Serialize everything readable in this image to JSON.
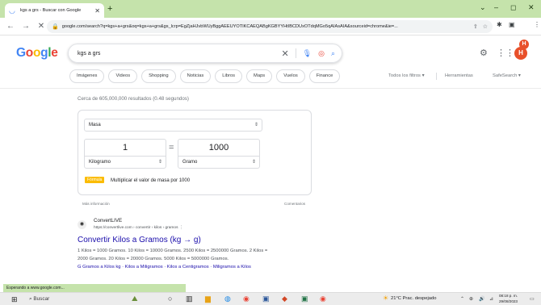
{
  "browser": {
    "tab_title": "kgs a grs - Buscar con Google",
    "url": "google.com/search?q=kgs+a+grs&oq=kgs+a+grs&gs_lcrp=EgZjaHJvbWUyBggAEEUYOTIKCAEQABgKGBYYHtIBCDUxOTdqMGo5qAIAsAIA&sourceid=chrome&ie=...",
    "status_text": "Esperando a www.google.com..."
  },
  "google": {
    "logo": "Google",
    "query": "kgs a grs",
    "avatar_letter": "H",
    "chips": [
      "Imágenes",
      "Videos",
      "Shopping",
      "Noticias",
      "Libros",
      "Maps",
      "Vuelos",
      "Finance"
    ],
    "filters": "Todos los filtros",
    "tools": "Herramientas",
    "safesearch": "SafeSearch",
    "stats": "Cerca de 605,000,000 resultados (0.48 segundos)"
  },
  "converter": {
    "category": "Masa",
    "from_value": "1",
    "to_value": "1000",
    "from_unit": "Kilogramo",
    "to_unit": "Gramo",
    "formula_label": "Fórmula",
    "formula_text": "Multiplicar el valor de masa por 1000",
    "more_info": "Más información",
    "feedback": "Comentarios"
  },
  "result": {
    "site_name": "ConvertLIVE",
    "url": "https://convertlive.com › convertir › kilos › gramos",
    "title": "Convertir Kilos a Gramos (kg → g)",
    "snippet_line1": "1 Kilos = 1000 Gramos. 10 Kilos = 10000 Gramos. 2500 Kilos = 2500000 Gramos. 2 Kilos =",
    "snippet_line2": "2000 Gramos. 20 Kilos = 20000 Gramos. 5000 Kilos = 5000000 Gramos.",
    "links": "G Gramos a Kilos kg · Kilos a Miligramos · Kilos a Centigramos · Miligramos a Kilos"
  },
  "taskbar": {
    "search_label": "Buscar",
    "weather": "21°C  Prac. despejado",
    "time": "08:18 p. m.",
    "date": "29/08/2023"
  },
  "colors": {
    "tabbar_bg": "#c5e3ab",
    "link_blue": "#1a0dab",
    "avatar": "#e8502a",
    "formula_badge": "#fbbc04"
  }
}
